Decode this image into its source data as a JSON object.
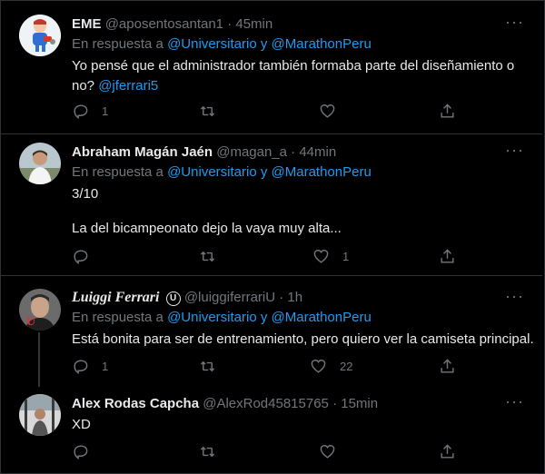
{
  "tweets": [
    {
      "name": "EME",
      "handle": "@aposentosantan1",
      "time": "45min",
      "reply_prefix": "En respuesta a",
      "reply_to_1": "@Universitario",
      "reply_join": "y",
      "reply_to_2": "@MarathonPeru",
      "text_1": "Yo pensé que el administrador también formaba parte del diseñamiento o",
      "text_2": "no?",
      "text_mention": "@jferrari5",
      "replies": "1",
      "retweets": "",
      "likes": ""
    },
    {
      "name": "Abraham Magán Jaén",
      "handle": "@magan_a",
      "time": "44min",
      "reply_prefix": "En respuesta a",
      "reply_to_1": "@Universitario",
      "reply_join": "y",
      "reply_to_2": "@MarathonPeru",
      "text_1": "3/10",
      "text_2": "La del bicampeonato dejo la vaya muy alta...",
      "replies": "",
      "retweets": "",
      "likes": "1"
    },
    {
      "name": "Luiggi Ferrari",
      "badge": "U",
      "handle": "@luiggiferrariU",
      "time": "1h",
      "reply_prefix": "En respuesta a",
      "reply_to_1": "@Universitario",
      "reply_join": "y",
      "reply_to_2": "@MarathonPeru",
      "text_1": "Está bonita para ser de entrenamiento, pero quiero ver la camiseta principal.",
      "replies": "1",
      "retweets": "",
      "likes": "22"
    },
    {
      "name": "Alex Rodas Capcha",
      "handle": "@AlexRod45815765",
      "time": "15min",
      "text_1": "XD",
      "replies": "",
      "retweets": "",
      "likes": ""
    }
  ],
  "separator": "·",
  "more_glyph": "···",
  "colors": {
    "background": "#000000",
    "link": "#1d9bf0",
    "muted": "#71767b",
    "text": "#e7e9ea",
    "divider": "#2f3336"
  },
  "icons": [
    "reply-icon",
    "retweet-icon",
    "like-icon",
    "share-icon",
    "more-icon"
  ]
}
